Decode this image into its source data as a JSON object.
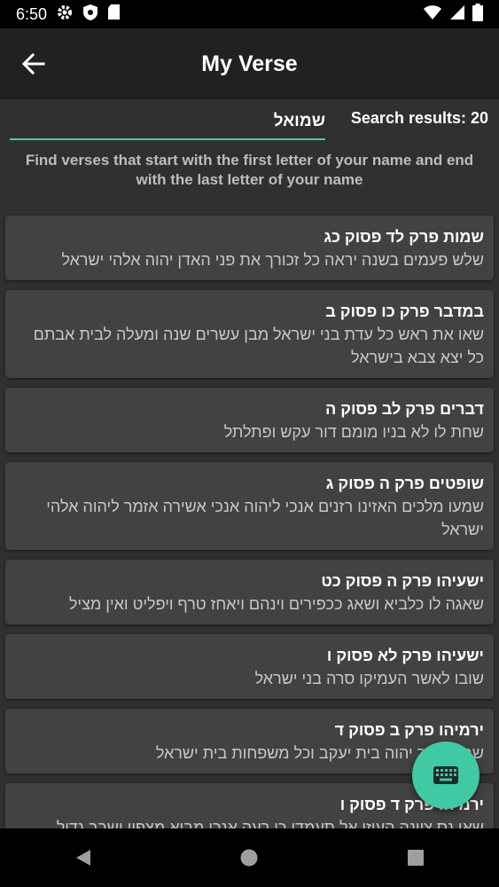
{
  "status": {
    "time": "6:50",
    "icons": [
      "gear-icon",
      "shield-icon",
      "sdcard-icon",
      "wifi-icon",
      "signal-icon",
      "battery-icon"
    ]
  },
  "appbar": {
    "title": "My Verse",
    "back_icon": "arrow-left-icon"
  },
  "search": {
    "value": "שמואל",
    "results_label": "Search results: 20"
  },
  "instructions": "Find verses that start with the first letter of your name and end with the last letter of your name",
  "verses": [
    {
      "ref": "שמות פרק לד פסוק כג",
      "text": "שלש פעמים בשנה יראה כל זכורך את פני האדן יהוה אלהי ישראל"
    },
    {
      "ref": "במדבר פרק כו פסוק ב",
      "text": "שאו את ראש כל עדת בני ישראל מבן עשרים שנה ומעלה לבית אבתם כל יצא צבא בישראל"
    },
    {
      "ref": "דברים פרק לב פסוק ה",
      "text": "שחת לו לא בניו מומם דור עקש ופתלתל"
    },
    {
      "ref": "שופטים פרק ה פסוק ג",
      "text": "שמעו מלכים האזינו רזנים אנכי ליהוה אנכי אשירה אזמר ליהוה אלהי ישראל"
    },
    {
      "ref": "ישעיהו פרק ה פסוק כט",
      "text": "שאגה לו כלביא ושאג ככפירים וינהם ויאחז טרף ויפליט ואין מציל"
    },
    {
      "ref": "ישעיהו פרק לא פסוק ו",
      "text": "שובו לאשר העמיקו סרה בני ישראל"
    },
    {
      "ref": "ירמיהו פרק ב פסוק ד",
      "text": "שמעו דבר יהוה בית יעקב וכל משפחות בית ישראל"
    },
    {
      "ref": "ירמיהו פרק ד פסוק ו",
      "text": "שאו נס ציונה העיזו אל תעמדו כי רעה אנכי מביא מצפון ושבר גדול"
    }
  ],
  "fab": {
    "icon": "keyboard-icon"
  },
  "navbar": {
    "icons": [
      "back-triangle-icon",
      "home-circle-icon",
      "recents-square-icon"
    ]
  },
  "colors": {
    "accent": "#40c9a2",
    "background": "#303030",
    "card": "#424242",
    "appbar": "#212121"
  }
}
